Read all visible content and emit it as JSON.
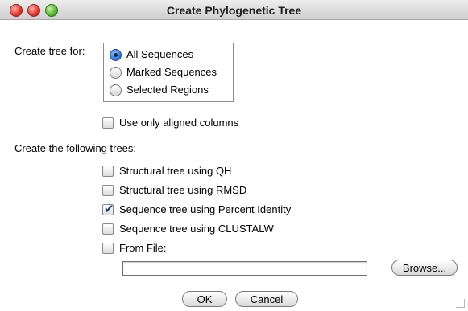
{
  "window": {
    "title": "Create Phylogenetic Tree"
  },
  "create_tree_for": {
    "label": "Create tree for:",
    "options": [
      {
        "label": "All Sequences",
        "selected": true
      },
      {
        "label": "Marked Sequences",
        "selected": false
      },
      {
        "label": "Selected Regions",
        "selected": false
      }
    ]
  },
  "use_aligned": {
    "label": "Use only aligned columns",
    "checked": false
  },
  "trees": {
    "heading": "Create the following trees:",
    "items": [
      {
        "label": "Structural tree using QH",
        "checked": false
      },
      {
        "label": "Structural tree using RMSD",
        "checked": false
      },
      {
        "label": "Sequence tree using Percent Identity",
        "checked": true
      },
      {
        "label": "Sequence tree using CLUSTALW",
        "checked": false
      },
      {
        "label": "From File:",
        "checked": false
      }
    ]
  },
  "file_path": {
    "value": "",
    "browse_label": "Browse..."
  },
  "buttons": {
    "ok": "OK",
    "cancel": "Cancel"
  }
}
